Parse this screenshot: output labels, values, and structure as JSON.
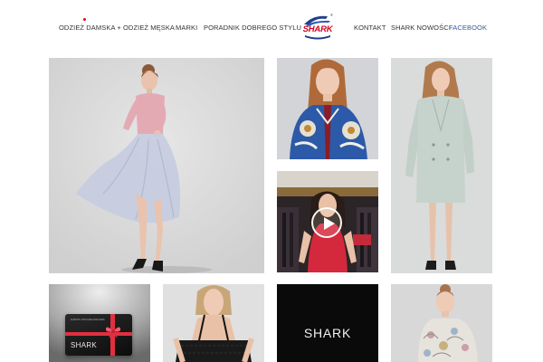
{
  "nav": {
    "left_items": [
      {
        "label": "ODZIEŻ DAMSKA +"
      },
      {
        "label": "ODZIEŻ MĘSKA"
      },
      {
        "label": "MARKI"
      },
      {
        "label": "PORADNIK DOBREGO STYLU"
      }
    ],
    "right_items": [
      {
        "label": "KONTAKT"
      },
      {
        "label": "SHARK NOWOŚCI"
      },
      {
        "label": "FACEBOOK"
      }
    ]
  },
  "logo": {
    "text": "SHARK",
    "registered": "®"
  },
  "colors": {
    "brand_red": "#d1001c",
    "brand_blue": "#1d3f8c",
    "facebook_blue": "#3b5998",
    "nav_text": "#333333"
  },
  "tiles": {
    "gift_card": {
      "label": "KARTA PODARUNKOWA",
      "brand": "SHARK"
    },
    "brand_tile": {
      "text": "SHARK"
    },
    "video": {
      "icon": "play-icon"
    }
  }
}
